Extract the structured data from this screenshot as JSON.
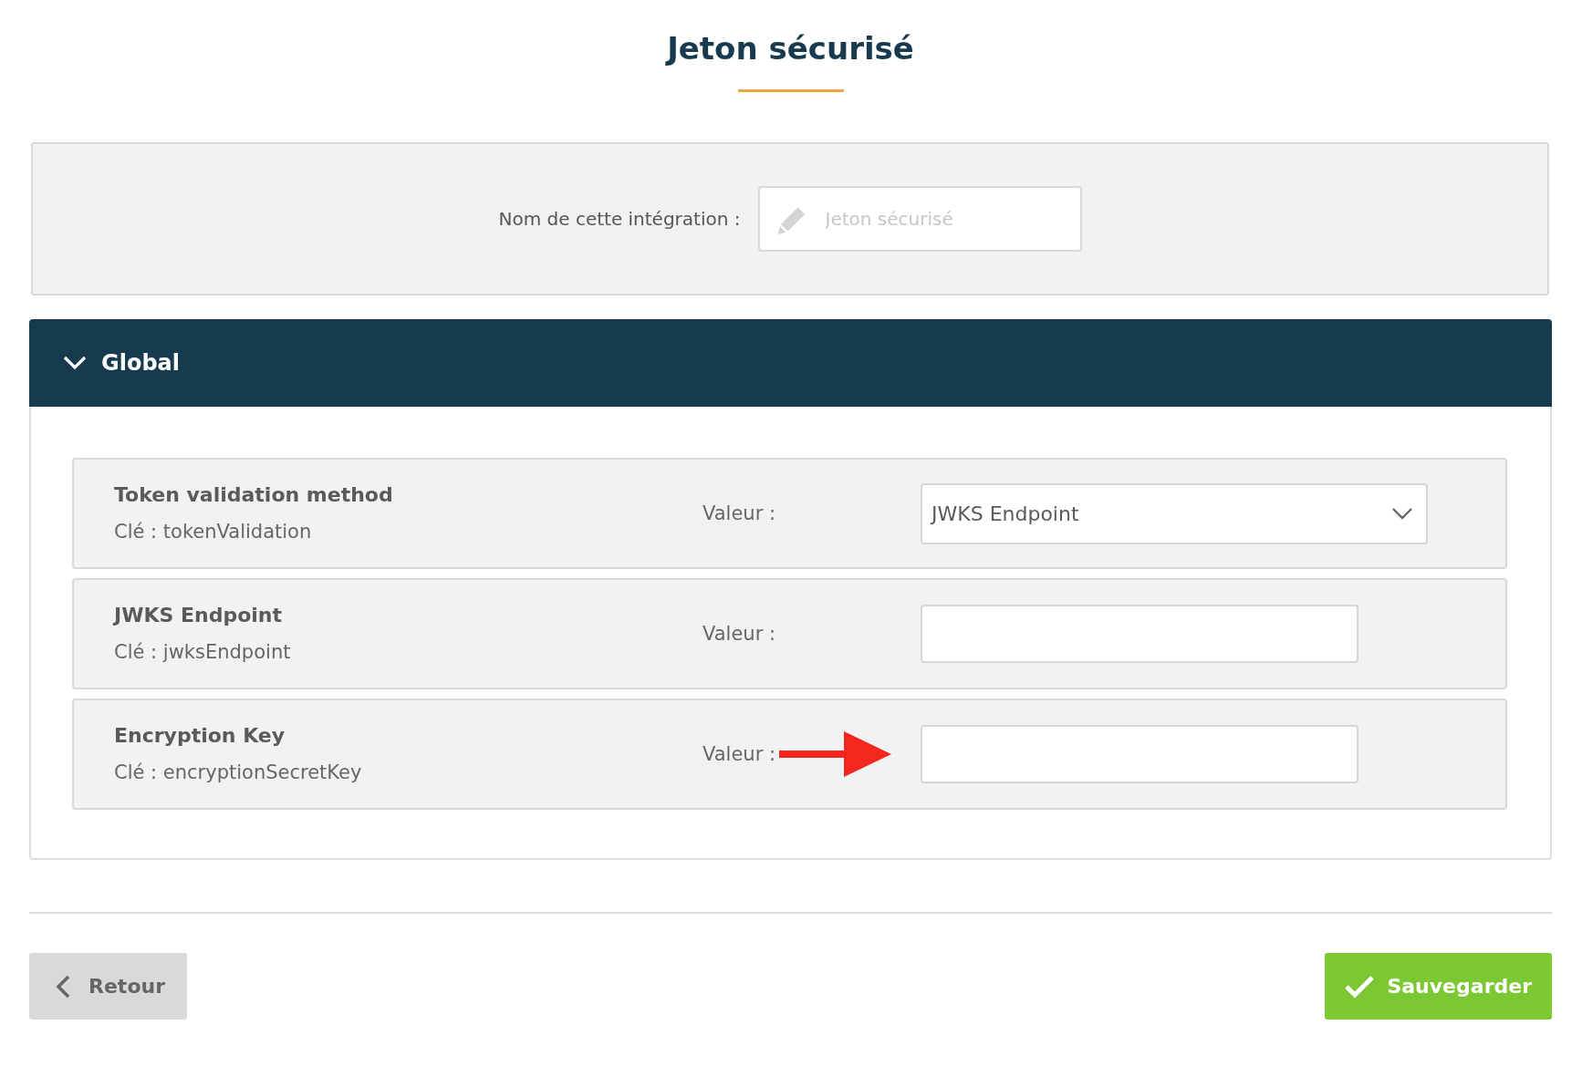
{
  "page_title": "Jeton sécurisé",
  "integration_name": {
    "label": "Nom de cette intégration :",
    "placeholder": "Jeton sécurisé"
  },
  "section": {
    "title": "Global",
    "expanded": true,
    "settings": [
      {
        "kind": "select",
        "title": "Token validation method",
        "key": "Clé : tokenValidation",
        "value_label": "Valeur :",
        "value": "JWKS Endpoint",
        "marked": false
      },
      {
        "kind": "text",
        "title": "JWKS Endpoint",
        "key": "Clé : jwksEndpoint",
        "value_label": "Valeur :",
        "marked": false
      },
      {
        "kind": "text",
        "title": "Encryption Key",
        "key": "Clé : encryptionSecretKey",
        "value_label": "Valeur :",
        "marked": true
      }
    ]
  },
  "buttons": [
    {
      "kind": "back",
      "label": "Retour"
    },
    {
      "kind": "save",
      "label": "Sauvegarder"
    }
  ]
}
